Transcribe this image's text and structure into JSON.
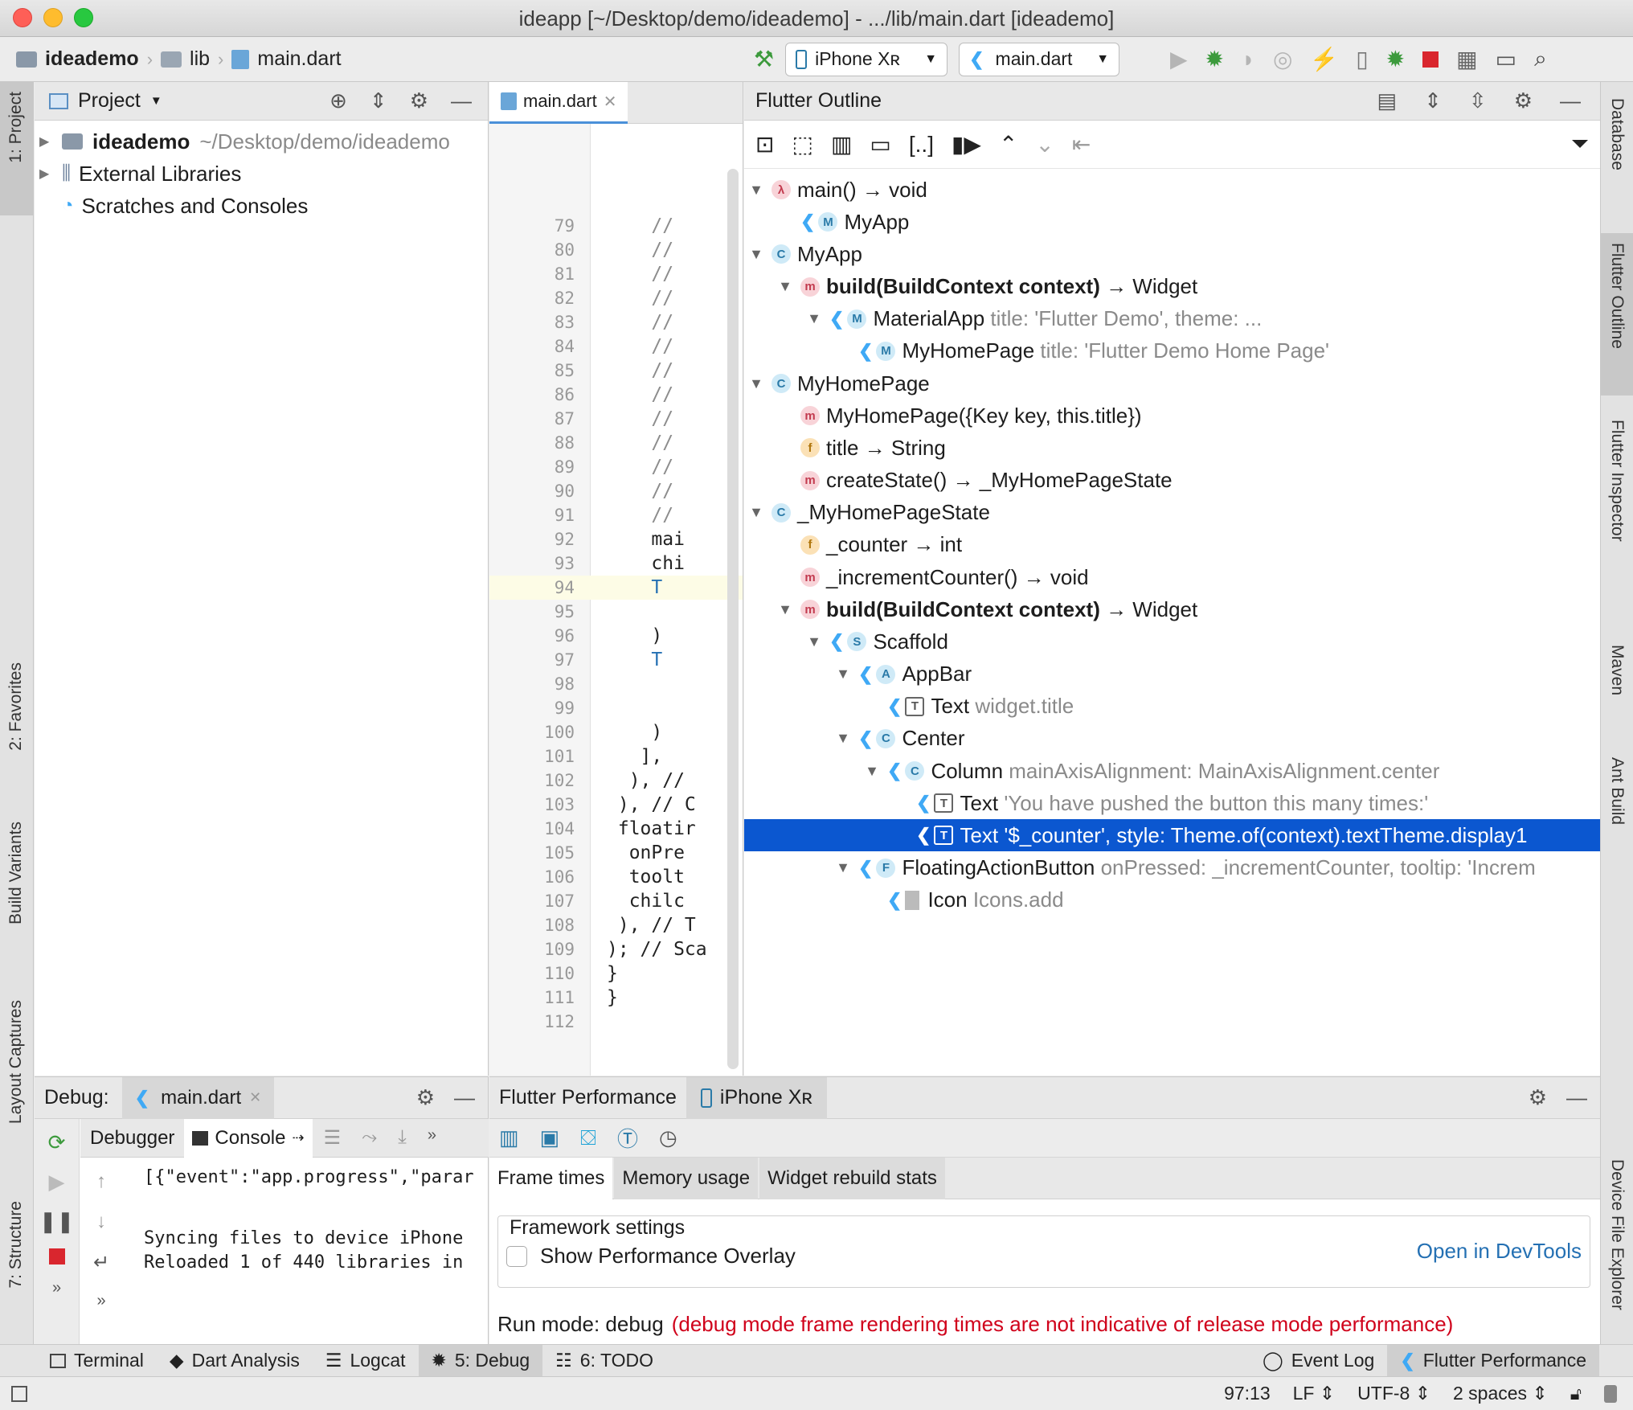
{
  "window": {
    "title": "ideapp [~/Desktop/demo/ideademo] - .../lib/main.dart [ideademo]"
  },
  "navbar": {
    "crumbs": [
      "ideademo",
      "lib",
      "main.dart"
    ],
    "device": "iPhone Xʀ",
    "run_config": "main.dart"
  },
  "left_stripe": {
    "project": "1: Project",
    "favorites": "2: Favorites",
    "build_variants": "Build Variants",
    "layout_captures": "Layout Captures",
    "structure": "7: Structure"
  },
  "right_stripe": {
    "database": "Database",
    "flutter_outline": "Flutter Outline",
    "flutter_inspector": "Flutter Inspector",
    "maven": "Maven",
    "ant_build": "Ant Build",
    "device_file_explorer": "Device File Explorer"
  },
  "project": {
    "header": "Project",
    "items": [
      {
        "name": "ideademo",
        "path": "~/Desktop/demo/ideademo"
      },
      {
        "name": "External Libraries"
      },
      {
        "name": "Scratches and Consoles"
      }
    ]
  },
  "editor": {
    "tab": "main.dart",
    "line_numbers": [
      "79",
      "80",
      "81",
      "82",
      "83",
      "84",
      "85",
      "86",
      "87",
      "88",
      "89",
      "90",
      "91",
      "92",
      "93",
      "94",
      "95",
      "96",
      "97",
      "98",
      "99",
      "100",
      "101",
      "102",
      "103",
      "104",
      "105",
      "106",
      "107",
      "108",
      "109",
      "110",
      "111",
      "112"
    ],
    "lines": [
      "    //",
      "    //",
      "    //",
      "    //",
      "    //",
      "    //",
      "    //",
      "    //",
      "    //",
      "    //",
      "    //",
      "    //",
      "    //",
      "    mai",
      "    chi",
      "    T",
      "",
      "    )",
      "    T",
      "",
      "",
      "    )",
      "   ],",
      "  ), //",
      " ), // C",
      " floatir",
      "  onPre",
      "  toolt",
      "  chilc",
      " ), // T",
      "); // Sca",
      "}",
      "}",
      ""
    ]
  },
  "outline": {
    "title": "Flutter Outline",
    "rows": [
      {
        "kind": "lam",
        "badge": "λ",
        "label": "main() → void",
        "detail": ""
      },
      {
        "kind": "w",
        "badge": "M",
        "label": "MyApp",
        "detail": ""
      },
      {
        "kind": "c",
        "badge": "C",
        "label": "MyApp",
        "detail": ""
      },
      {
        "kind": "m",
        "badge": "m",
        "label": "build(BuildContext context)",
        "ret": " → Widget",
        "detail": ""
      },
      {
        "kind": "w",
        "badge": "M",
        "label": "MaterialApp",
        "detail": " title: 'Flutter Demo', theme: ..."
      },
      {
        "kind": "w",
        "badge": "M",
        "label": "MyHomePage",
        "detail": " title: 'Flutter Demo Home Page'"
      },
      {
        "kind": "c",
        "badge": "C",
        "label": "MyHomePage",
        "detail": ""
      },
      {
        "kind": "m",
        "badge": "m",
        "label": "MyHomePage({Key key, this.title})",
        "detail": ""
      },
      {
        "kind": "f",
        "badge": "f",
        "label": "title → String",
        "detail": ""
      },
      {
        "kind": "m",
        "badge": "m",
        "label": "createState() → _MyHomePageState",
        "detail": ""
      },
      {
        "kind": "c",
        "badge": "C",
        "label": "_MyHomePageState",
        "detail": ""
      },
      {
        "kind": "f",
        "badge": "f",
        "label": "_counter → int",
        "detail": ""
      },
      {
        "kind": "m",
        "badge": "m",
        "label": "_incrementCounter() → void",
        "detail": ""
      },
      {
        "kind": "m",
        "badge": "m",
        "label": "build(BuildContext context)",
        "ret": " → Widget",
        "detail": ""
      },
      {
        "kind": "w",
        "badge": "S",
        "label": "Scaffold",
        "detail": ""
      },
      {
        "kind": "w",
        "badge": "A",
        "label": "AppBar",
        "detail": ""
      },
      {
        "kind": "t",
        "badge": "T",
        "label": "Text",
        "detail": " widget.title"
      },
      {
        "kind": "w",
        "badge": "C",
        "label": "Center",
        "detail": ""
      },
      {
        "kind": "w",
        "badge": "C",
        "label": "Column",
        "detail": " mainAxisAlignment: MainAxisAlignment.center"
      },
      {
        "kind": "t",
        "badge": "T",
        "label": "Text",
        "detail": " 'You have pushed the button this many times:'"
      },
      {
        "kind": "t",
        "badge": "T",
        "label": "Text",
        "detail": " '$_counter', style: Theme.of(context).textTheme.display1"
      },
      {
        "kind": "w",
        "badge": "F",
        "label": "FloatingActionButton",
        "detail": " onPressed: _incrementCounter, tooltip: 'Increm"
      },
      {
        "kind": "i",
        "badge": "",
        "label": "Icon",
        "detail": " Icons.add"
      }
    ]
  },
  "debug": {
    "label": "Debug:",
    "tab": "main.dart",
    "subtabs": [
      "Debugger",
      "Console"
    ],
    "console_lines": [
      "[{\"event\":\"app.progress\",\"parar",
      "",
      "Syncing files to device iPhone",
      "Reloaded 1 of 440 libraries in"
    ]
  },
  "perf": {
    "tabs": [
      "Flutter Performance",
      "iPhone Xʀ"
    ],
    "subtabs": [
      "Frame times",
      "Memory usage",
      "Widget rebuild stats"
    ],
    "framework_settings": "Framework settings",
    "checkbox_label": "Show Performance Overlay",
    "open_devtools": "Open in DevTools",
    "run_mode": "Run mode: debug",
    "run_mode_note": "(debug mode frame rendering times are not indicative of release mode performance)"
  },
  "bottom_tabs": [
    "Terminal",
    "Dart Analysis",
    "Logcat",
    "5: Debug",
    "6: TODO"
  ],
  "bottom_tabs_right": [
    "Event Log",
    "Flutter Performance"
  ],
  "status": {
    "position": "97:13",
    "line_sep": "LF",
    "encoding": "UTF-8",
    "indent": "2 spaces"
  },
  "colors": {
    "selection": "#0b57d0",
    "link": "#2470b3",
    "warning": "#d0021b",
    "accent_flutter": "#3fa9f5"
  }
}
